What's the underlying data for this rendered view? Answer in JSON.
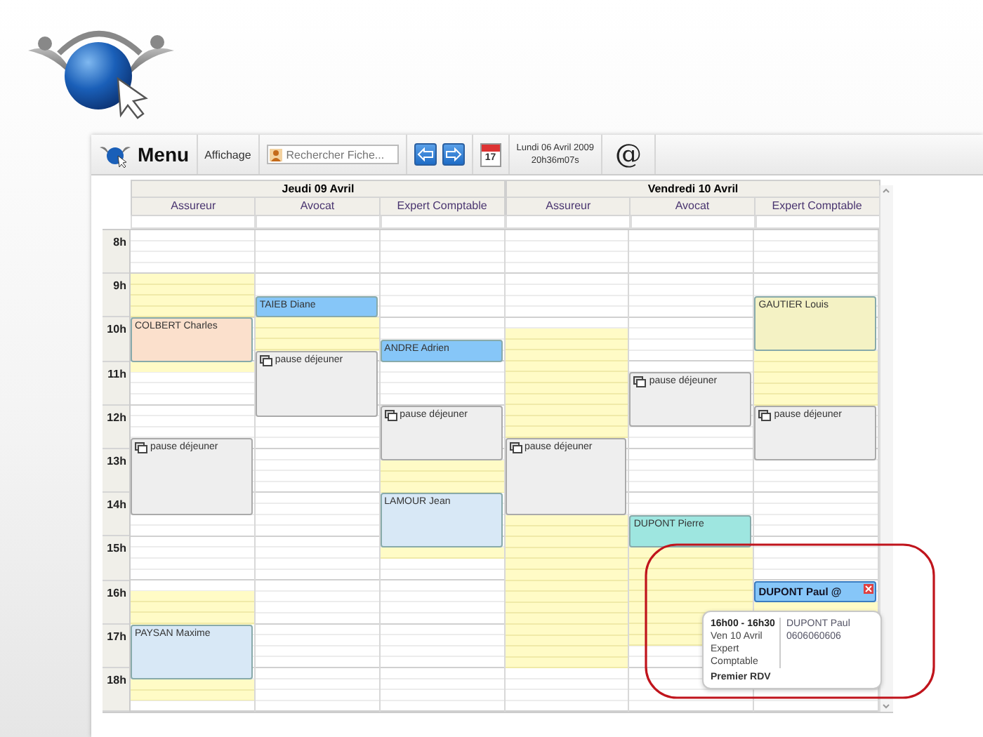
{
  "toolbar": {
    "menu_label": "Menu",
    "view_label": "Affichage",
    "search": {
      "placeholder": "Rechercher Fiche..."
    },
    "calendar_day": "17",
    "date": "Lundi 06 Avril 2009",
    "time": "20h36m07s",
    "email_button": "@"
  },
  "calendar": {
    "hours": [
      "8h",
      "9h",
      "10h",
      "11h",
      "12h",
      "13h",
      "14h",
      "15h",
      "16h",
      "17h",
      "18h"
    ],
    "days": [
      {
        "title": "Jeudi 09 Avril",
        "resources": [
          {
            "name": "Assureur",
            "events": [
              {
                "kind": "appointment",
                "label": "COLBERT Charles",
                "color": "#fbe0cc",
                "selected": false
              },
              {
                "kind": "break",
                "label": "pause déjeuner",
                "selected": false
              },
              {
                "kind": "appointment",
                "label": "PAYSAN Maxime",
                "color": "#d8e8f6",
                "selected": false
              }
            ]
          },
          {
            "name": "Avocat",
            "events": [
              {
                "kind": "appointment",
                "label": "TAIEB Diane",
                "color": "#86c6f8",
                "selected": false
              },
              {
                "kind": "break",
                "label": "pause déjeuner",
                "selected": false
              }
            ]
          },
          {
            "name": "Expert Comptable",
            "events": [
              {
                "kind": "appointment",
                "label": "ANDRE Adrien",
                "color": "#86c6f8",
                "selected": false
              },
              {
                "kind": "break",
                "label": "pause déjeuner",
                "selected": false
              },
              {
                "kind": "appointment",
                "label": "LAMOUR Jean",
                "color": "#d8e8f6",
                "selected": false
              }
            ]
          }
        ]
      },
      {
        "title": "Vendredi 10 Avril",
        "resources": [
          {
            "name": "Assureur",
            "events": [
              {
                "kind": "break",
                "label": "pause déjeuner",
                "selected": false
              }
            ]
          },
          {
            "name": "Avocat",
            "events": [
              {
                "kind": "break",
                "label": "pause déjeuner",
                "selected": false
              },
              {
                "kind": "appointment",
                "label": "DUPONT Pierre",
                "color": "#9ee6e0",
                "selected": false
              }
            ]
          },
          {
            "name": "Expert Comptable",
            "events": [
              {
                "kind": "appointment",
                "label": "GAUTIER Louis",
                "color": "#f4f2c4",
                "selected": false
              },
              {
                "kind": "break",
                "label": "pause déjeuner",
                "selected": false
              },
              {
                "kind": "appointment",
                "label": "DUPONT Paul @",
                "color": "#86c6f8",
                "selected": true
              }
            ]
          }
        ]
      }
    ]
  },
  "popup": {
    "time_range": "16h00 - 16h30",
    "date": "Ven 10 Avril",
    "resource": "Expert Comptable",
    "client": "DUPONT Paul",
    "phone": "0606060606",
    "note": "Premier RDV"
  }
}
